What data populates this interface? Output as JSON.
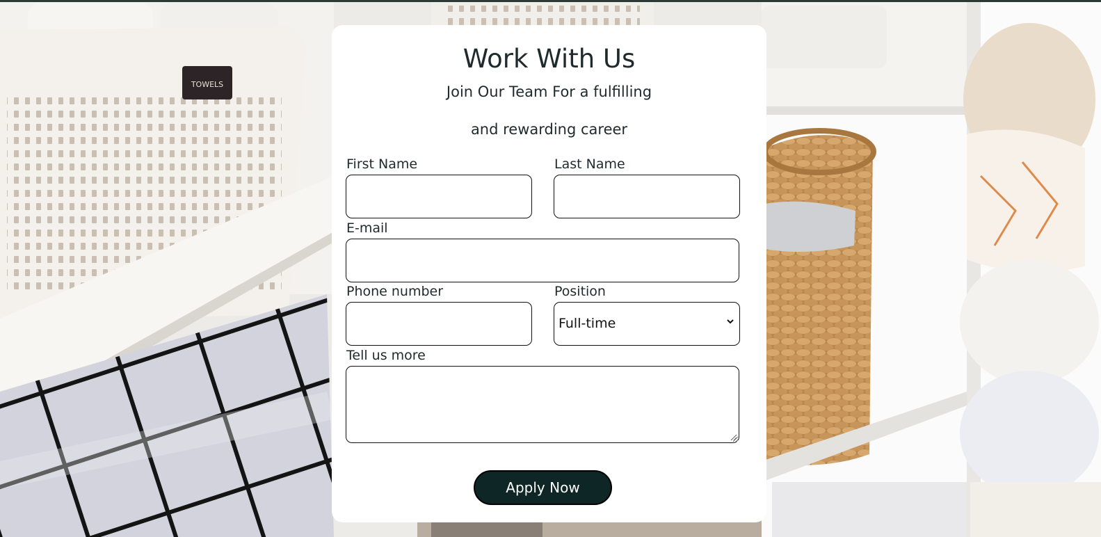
{
  "form": {
    "title": "Work With Us",
    "subtitle_line1": "Join Our Team For a fulfilling",
    "subtitle_line2": "and rewarding career",
    "fields": {
      "first_name_label": "First Name",
      "last_name_label": "Last Name",
      "email_label": "E-mail",
      "phone_label": "Phone number",
      "position_label": "Position",
      "position_value": "Full-time",
      "message_label": "Tell us more"
    },
    "submit_label": "Apply Now"
  },
  "colors": {
    "button_bg": "#0e2625",
    "button_text": "#ffffff",
    "card_bg": "#ffffff",
    "text": "#1f2a2c"
  }
}
